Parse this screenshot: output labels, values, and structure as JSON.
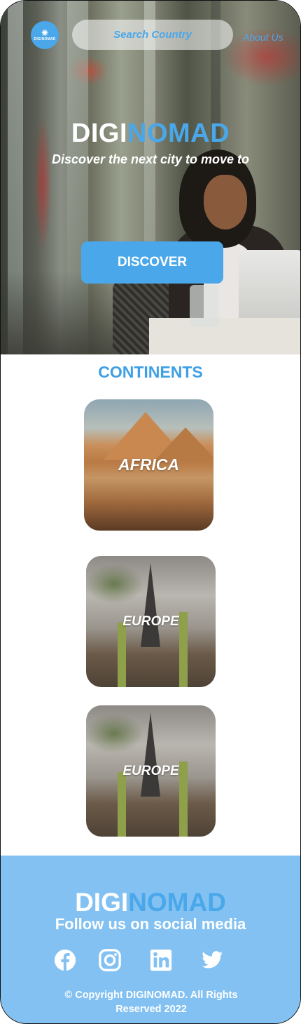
{
  "header": {
    "logo_text": "DIGINOMAD",
    "search_placeholder": "Search Country",
    "about_link": "About Us"
  },
  "hero": {
    "brand_part1": "DIGI",
    "brand_part2": "NOMAD",
    "tagline": "Discover the next city to move to",
    "discover_label": "DISCOVER"
  },
  "continents": {
    "title": "CONTINENTS",
    "cards": [
      {
        "label": "AFRICA"
      },
      {
        "label": "EUROPE"
      },
      {
        "label": "EUROPE"
      }
    ]
  },
  "footer": {
    "brand_part1": "DIGI",
    "brand_part2": "NOMAD",
    "follow_text": "Follow us on social media",
    "socials": [
      "facebook-icon",
      "instagram-icon",
      "linkedin-icon",
      "twitter-icon"
    ],
    "copyright_line1": "Copyright DIGINOMAD. All Rights",
    "copyright_line2": "Reserved 2022"
  },
  "colors": {
    "accent": "#4aa8ea",
    "footer_bg": "#82c1f2",
    "title": "#3d9fe4"
  }
}
